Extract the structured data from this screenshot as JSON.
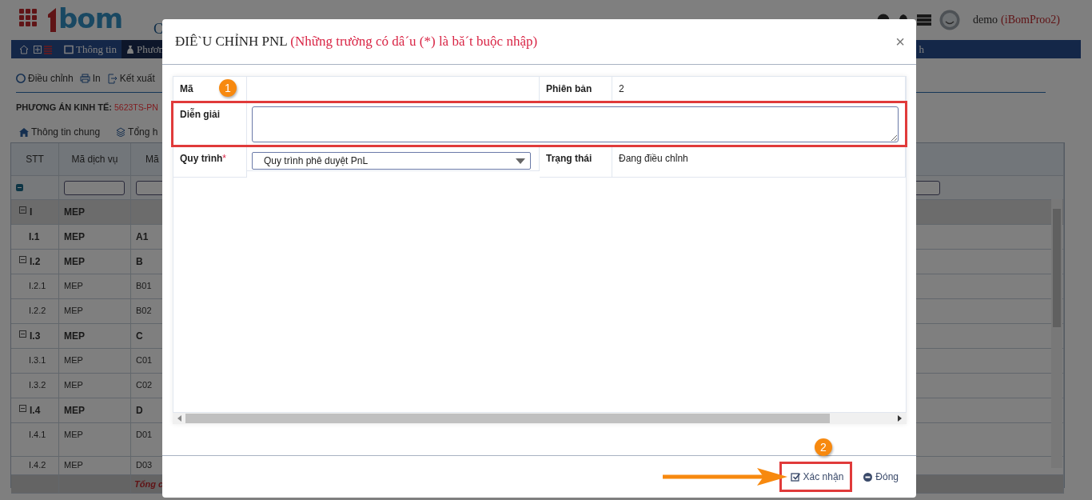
{
  "header": {
    "logo_text": "bom",
    "title": "C",
    "user": {
      "name": "demo",
      "account": "(iBomProo2)"
    }
  },
  "nav": {
    "items": [
      {
        "label": "Thông tin",
        "selected": false
      },
      {
        "label": "Phươn",
        "selected": true
      }
    ],
    "right_text": "h"
  },
  "toolbar": [
    {
      "label": "Điều chỉnh"
    },
    {
      "label": "In"
    },
    {
      "label": "Kết xuất"
    }
  ],
  "plan": {
    "label": "PHƯƠNG ÁN KINH TẾ:",
    "code": "5623TS-PN"
  },
  "tabs": [
    {
      "label": "Thông tin chung"
    },
    {
      "label": "Tổng h"
    }
  ],
  "table": {
    "columns": [
      "STT",
      "Mã dịch vụ",
      "Mã"
    ],
    "rows": [
      {
        "stt": "I",
        "service": "MEP",
        "bold": true,
        "expanded": true,
        "children": [
          {
            "stt": "I.1",
            "service": "MEP",
            "code": "A1",
            "bold": true
          },
          {
            "stt": "I.2",
            "service": "MEP",
            "code": "B",
            "bold": true,
            "expanded": true,
            "children": [
              {
                "stt": "I.2.1",
                "service": "MEP",
                "code": "B01",
                "bold": false
              },
              {
                "stt": "I.2.2",
                "service": "MEP",
                "code": "B02",
                "bold": false
              }
            ]
          },
          {
            "stt": "I.3",
            "service": "MEP",
            "code": "C",
            "bold": true,
            "expanded": true,
            "children": [
              {
                "stt": "I.3.1",
                "service": "MEP",
                "code": "C01",
                "bold": false
              },
              {
                "stt": "I.3.2",
                "service": "MEP",
                "code": "C02",
                "bold": false
              }
            ]
          },
          {
            "stt": "I.4",
            "service": "MEP",
            "code": "D",
            "bold": true,
            "expanded": true,
            "children": [
              {
                "stt": "I.4.1",
                "service": "MEP",
                "code": "D01",
                "bold": false
              },
              {
                "stt": "I.4.2",
                "service": "MEP",
                "code": "D03",
                "bold": false
              }
            ]
          }
        ]
      }
    ],
    "total_label": "Tổng c"
  },
  "modal": {
    "title": "ĐIÊ`U CHỈNH PNL",
    "note": "(Những trường có dâ´u (*) là bă´t buộc nhập)",
    "close_label": "×",
    "fields": {
      "code": {
        "label": "Mã"
      },
      "version": {
        "label": "Phiên bản",
        "value": "2"
      },
      "description": {
        "label": "Diễn giải"
      },
      "process": {
        "label": "Quy trình",
        "required_mark": "*",
        "value": "Quy trình phê duyệt PnL"
      },
      "status": {
        "label": "Trạng thái",
        "value": "Đang điều chỉnh"
      }
    },
    "buttons": [
      {
        "label": "Xác nhận",
        "kind": "confirm"
      },
      {
        "label": "Đóng",
        "kind": "close"
      }
    ]
  },
  "annotations": [
    {
      "label": "1"
    },
    {
      "label": "2"
    }
  ]
}
